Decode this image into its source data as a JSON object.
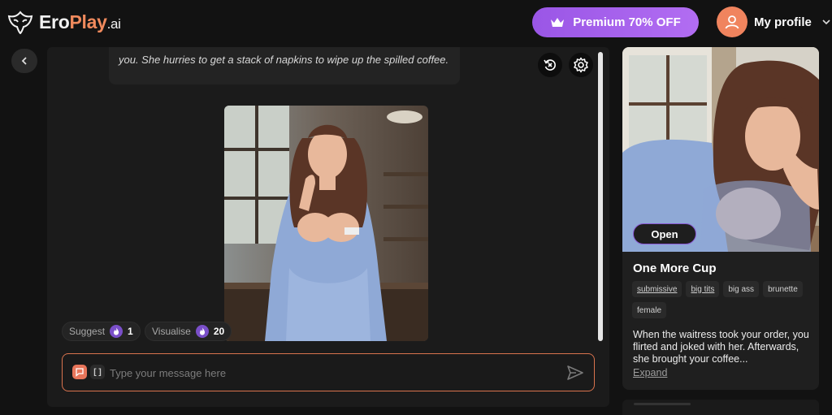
{
  "header": {
    "logo_part1": "Ero",
    "logo_part2": "Play",
    "logo_part3": ".ai",
    "premium_label": "Premium 70% OFF",
    "profile_label": "My profile"
  },
  "chat": {
    "message_text": "you. She hurries to get a stack of napkins to wipe up the spilled coffee.",
    "suggest_label": "Suggest",
    "suggest_count": "1",
    "visualise_label": "Visualise",
    "visualise_count": "20",
    "input_placeholder": "Type your message here",
    "brackets_icon_text": "[ ]",
    "scroll_progress": 1.0
  },
  "character": {
    "open_label": "Open",
    "title": "One More Cup",
    "tags": [
      {
        "label": "submissive",
        "link": true
      },
      {
        "label": "big tits",
        "link": true
      },
      {
        "label": "big ass",
        "link": false
      },
      {
        "label": "brunette",
        "link": false
      },
      {
        "label": "female",
        "link": false
      }
    ],
    "description": "When the waitress took your order, you flirted and joked with her. Afterwards, she brought your coffee...",
    "expand_label": "Expand"
  },
  "colors": {
    "accent_orange": "#d9734e",
    "accent_purple": "#9a56e6",
    "avatar_orange": "#f0845e"
  },
  "icons": [
    "back-chevron-icon",
    "reset-icon",
    "gear-icon",
    "crown-icon",
    "user-icon",
    "chevron-down-icon",
    "flame-icon",
    "chat-bubble-icon",
    "send-icon"
  ]
}
